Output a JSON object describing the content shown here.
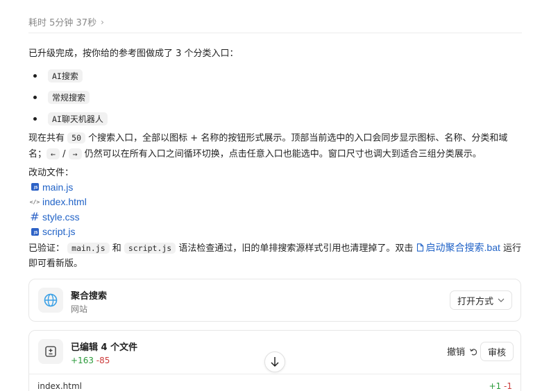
{
  "header": {
    "elapsed": "耗时 5分钟 37秒",
    "chevron": "›"
  },
  "intro": "已升级完成，按你给的参考图做成了 3 个分类入口：",
  "categories": [
    {
      "code": "AI",
      "label": "搜索"
    },
    {
      "code": "",
      "label": "常规搜索"
    },
    {
      "code": "AI",
      "label": "聊天机器人"
    }
  ],
  "para1": {
    "t1": "现在共有",
    "count": "50",
    "t2": "个搜索入口，全部以图标 + 名称的按钮形式展示。顶部当前选中的入口会同步显示图标、名称、分类和域名；",
    "key_left": "←",
    "slash": "/",
    "key_right": "→",
    "t3": "仍然可以在所有入口之间循环切换，点击任意入口也能选中。窗口尺寸也调大到适合三组分类展示。"
  },
  "files_label": "改动文件：",
  "files": [
    {
      "name": "main.js",
      "icon": "js-file-icon"
    },
    {
      "name": "index.html",
      "icon": "html-file-icon"
    },
    {
      "name": "style.css",
      "icon": "css-file-icon"
    },
    {
      "name": "script.js",
      "icon": "js-file-icon"
    }
  ],
  "para2": {
    "t1": "已验证：",
    "f1": "main.js",
    "and": "和",
    "f2": "script.js",
    "t2": "语法检查通过，旧的单排搜索源样式引用也清理掉了。双击",
    "link": "启动聚合搜索.bat",
    "t3": "运行即可看新版。"
  },
  "app_card": {
    "title": "聚合搜索",
    "subtitle": "网站",
    "open_label": "打开方式"
  },
  "edit_card": {
    "title": "已编辑 4 个文件",
    "added": "+163",
    "removed": "-85",
    "undo_label": "撤销",
    "review_label": "审核",
    "row_file": "index.html",
    "row_added": "+1",
    "row_removed": "-1"
  },
  "colors": {
    "link": "#2163c7",
    "added": "#2a9a3a",
    "removed": "#cc3b3b",
    "globe": "#3aa0e6"
  }
}
